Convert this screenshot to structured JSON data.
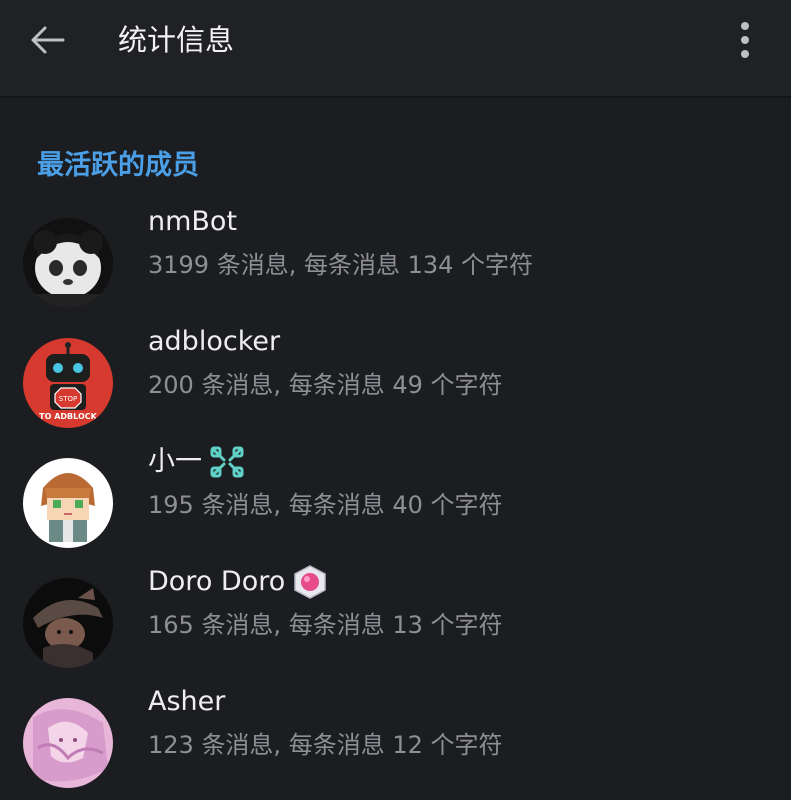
{
  "header": {
    "back_icon": "arrow-left-icon",
    "title": "统计信息",
    "menu_icon": "more-vertical-icon"
  },
  "section": {
    "title": "最活跃的成员"
  },
  "members": [
    {
      "name": "nmBot",
      "stats": "3199 条消息, 每条消息 134 个字符",
      "avatar_icon": "panda-avatar"
    },
    {
      "name": "adblocker",
      "stats": "200 条消息, 每条消息 49 个字符",
      "avatar_icon": "robot-stop-avatar",
      "avatar_text": "STOP",
      "avatar_caption": "TO ADBLOCK"
    },
    {
      "name": "小一",
      "stats": "195 条消息, 每条消息 40 个字符",
      "avatar_icon": "anime-boy-avatar",
      "badge_icon": "premium-x-badge-icon"
    },
    {
      "name": "Doro Doro",
      "stats": "165 条消息, 每条消息 13 个字符",
      "avatar_icon": "dark-figure-avatar",
      "badge_icon": "pink-gem-badge-icon"
    },
    {
      "name": "Asher",
      "stats": "123 条消息, 每条消息 12 个字符",
      "avatar_icon": "pink-anime-avatar"
    }
  ],
  "colors": {
    "background": "#1c1d21",
    "header": "#202125",
    "accent": "#4a9fe6",
    "secondary_text": "#8e8f95"
  }
}
